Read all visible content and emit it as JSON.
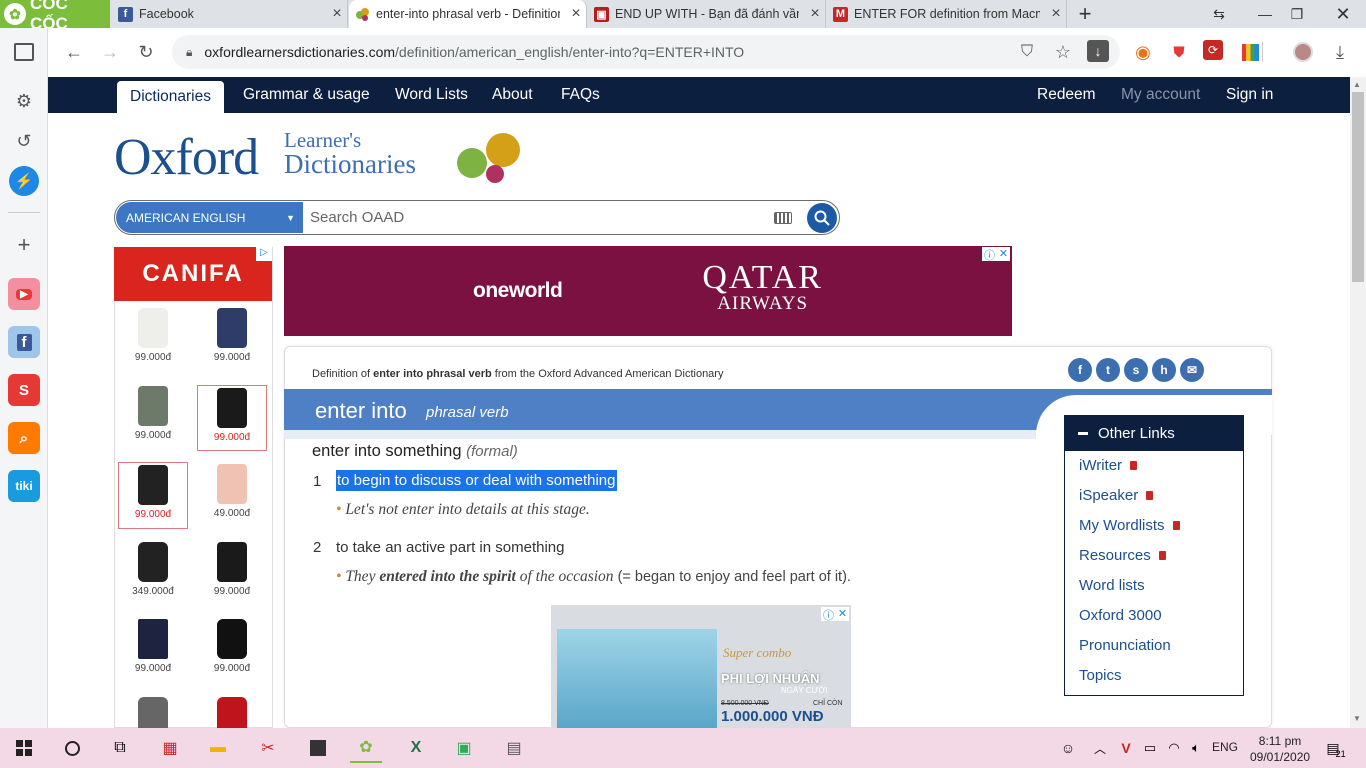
{
  "browser": {
    "brand": "CỐC CỐC",
    "tabs": [
      {
        "title": "Facebook",
        "icon": "facebook-icon",
        "color": "#3b5998"
      },
      {
        "title": "enter-into phrasal verb - Definition",
        "icon": "oxford-icon",
        "color": "#4caf50"
      },
      {
        "title": "END UP WITH - Bạn đã đánh vần d",
        "icon": "cambridge-icon",
        "color": "#b71c1c"
      },
      {
        "title": "ENTER FOR definition from Macmi",
        "icon": "macmillan-icon",
        "color": "#c62828"
      }
    ],
    "url_domain": "oxfordlearnersdictionaries.com",
    "url_path": "/definition/american_english/enter-into?q=ENTER+INTO"
  },
  "nav": {
    "items": [
      "Dictionaries",
      "Grammar & usage",
      "Word Lists",
      "About",
      "FAQs"
    ],
    "right": [
      "Redeem",
      "My account",
      "Sign in"
    ]
  },
  "logo": {
    "main": "Oxford",
    "line1": "Learner's",
    "line2": "Dictionaries"
  },
  "search": {
    "lang": "AMERICAN ENGLISH",
    "placeholder": "Search OAAD"
  },
  "leftad": {
    "brand": "CANIFA",
    "prices": [
      "99.000đ",
      "99.000đ",
      "99.000đ",
      "99.000đ",
      "99.000đ",
      "49.000đ",
      "349.000đ",
      "99.000đ",
      "99.000đ",
      "99.000đ"
    ]
  },
  "banner": {
    "left": "oneworld",
    "right1": "QATAR",
    "right2": "AIRWAYS"
  },
  "entry": {
    "def_prefix": "Definition of ",
    "def_bold": "enter into phrasal verb",
    "def_suffix": " from the Oxford Advanced American Dictionary",
    "headword": "enter into",
    "pos": "phrasal verb",
    "pattern": "enter into something",
    "register": "(formal)",
    "senses": [
      {
        "num": "1",
        "def": "to begin to discuss or deal with something",
        "ex_pre": "Let's not enter into details at this stage.",
        "ex_bold": "",
        "ex_post": "",
        "gloss": ""
      },
      {
        "num": "2",
        "def": "to take an active part in something",
        "ex_pre": "They ",
        "ex_bold": "entered into the spirit",
        "ex_post": " of the occasion",
        "gloss": " (= began to enjoy and feel part of it)."
      }
    ]
  },
  "otherlinks": {
    "title": "Other Links",
    "items": [
      {
        "label": "iWriter",
        "locked": true
      },
      {
        "label": "iSpeaker",
        "locked": true
      },
      {
        "label": "My Wordlists",
        "locked": true
      },
      {
        "label": "Resources",
        "locked": true
      },
      {
        "label": "Word lists",
        "locked": false
      },
      {
        "label": "Oxford 3000",
        "locked": false
      },
      {
        "label": "Pronunciation",
        "locked": false
      },
      {
        "label": "Topics",
        "locked": false
      }
    ]
  },
  "bottomad": {
    "line1": "Super combo",
    "line2": "PHI LỢI NHUẬN",
    "line3": "NGÀY CƯỚI",
    "old": "8.500.000 VNĐ",
    "only": "CHỈ CÒN",
    "price": "1.000.000 VNĐ"
  },
  "taskbar": {
    "lang": "ENG",
    "time": "8:11 pm",
    "date": "09/01/2020",
    "notif": "21"
  },
  "colors": {
    "navy": "#0d1f3f",
    "blue": "#4f7fc4",
    "highlight": "#1a73e8"
  }
}
